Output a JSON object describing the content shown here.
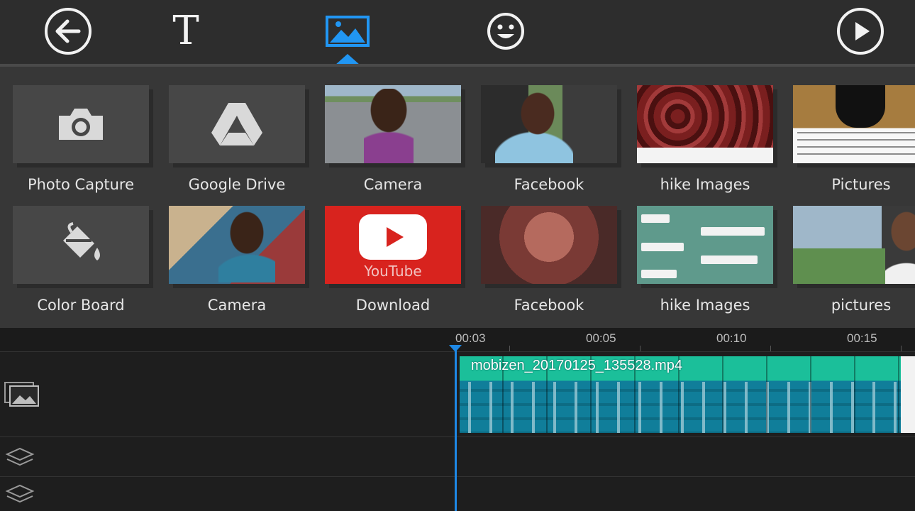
{
  "toolbar": {
    "back_icon": "arrow-left-icon",
    "text_tool_glyph": "T",
    "image_icon": "image-icon",
    "sticker_icon": "smiley-icon",
    "play_icon": "play-icon",
    "accent": "#2196f3"
  },
  "media": {
    "row1": [
      {
        "label": "Photo Capture",
        "icon": "camera-icon"
      },
      {
        "label": "Google Drive",
        "icon": "google-drive-icon"
      },
      {
        "label": "Camera"
      },
      {
        "label": "Facebook"
      },
      {
        "label": "hike Images"
      },
      {
        "label": "Pictures"
      }
    ],
    "row2": [
      {
        "label": "Color Board",
        "icon": "paint-bucket-icon"
      },
      {
        "label": "Camera"
      },
      {
        "label": "Download",
        "thumb_text": "YouTube"
      },
      {
        "label": "Facebook"
      },
      {
        "label": "hike Images"
      },
      {
        "label": "pictures"
      }
    ]
  },
  "timeline": {
    "ticks": [
      "00:03",
      "00:05",
      "00:10",
      "00:15"
    ],
    "clip_name": "mobizen_20170125_135528.mp4",
    "clip_color": "#1bbf9a",
    "track_icons": [
      "image-track-icon",
      "layers-icon",
      "layers-icon"
    ]
  }
}
